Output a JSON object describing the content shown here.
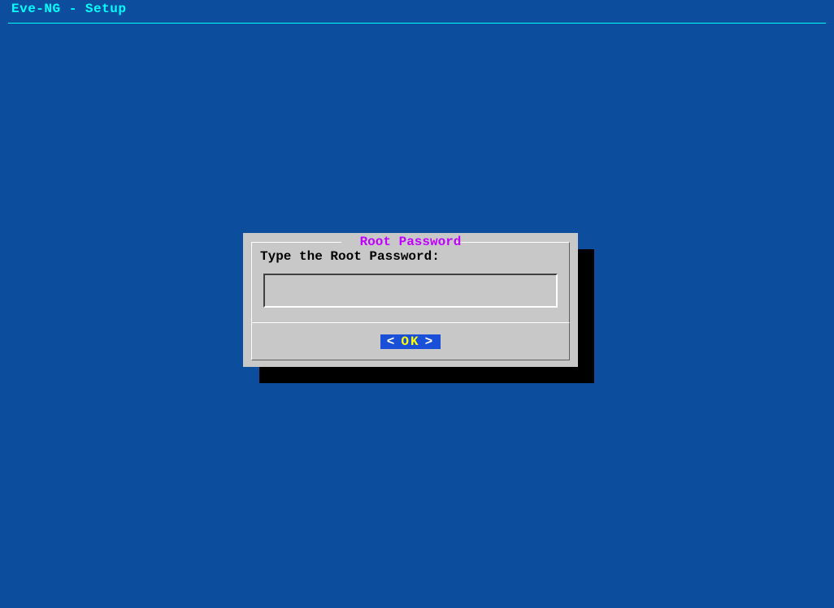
{
  "header": {
    "title": "Eve-NG - Setup"
  },
  "dialog": {
    "title": "Root Password",
    "prompt": "Type the Root Password:",
    "input_value": "",
    "ok_label": "OK"
  }
}
